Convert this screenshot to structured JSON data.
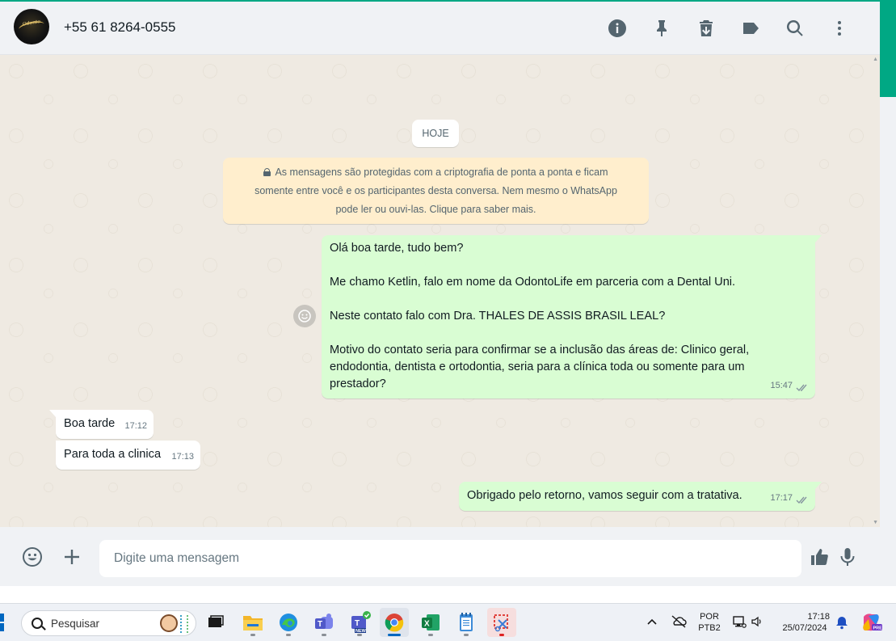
{
  "header": {
    "contact_name": "+55 61 8264-0555",
    "avatar_text": "Odonto",
    "icons": [
      "info-icon",
      "pin-icon",
      "delete-icon",
      "label-icon",
      "search-icon",
      "more-options-icon"
    ]
  },
  "chat": {
    "date_chip": "HOJE",
    "encryption_notice": "As mensagens são protegidas com a criptografia de ponta a ponta e ficam\nsomente entre você e os participantes desta conversa. Nem mesmo o WhatsApp\npode ler ou ouvi-las. Clique para saber mais.",
    "messages": [
      {
        "direction": "out",
        "text": "Olá boa tarde, tudo bem?\n\nMe chamo Ketlin, falo em nome da OdontoLife em parceria com a Dental Uni.\n\nNeste contato falo com Dra. THALES DE ASSIS BRASIL LEAL?\n\nMotivo do contato seria para confirmar se a inclusão das áreas de: Clinico geral,\nendodontia, dentista e ortodontia, seria para a clínica toda ou somente para um\nprestador?",
        "time": "15:47",
        "status": "read"
      },
      {
        "direction": "in",
        "text": "Boa tarde",
        "time": "17:12"
      },
      {
        "direction": "in",
        "text": "Para toda a clinica",
        "time": "17:13"
      },
      {
        "direction": "out",
        "text": "Obrigado pelo retorno, vamos seguir com a tratativa.",
        "time": "17:17",
        "status": "read"
      }
    ]
  },
  "composer": {
    "placeholder": "Digite uma mensagem",
    "icons": [
      "emoji-icon",
      "attach-plus-icon",
      "sticker-icon",
      "microphone-icon"
    ]
  },
  "taskbar": {
    "search_label": "Pesquisar",
    "apps": [
      "task-view-icon",
      "file-explorer-icon",
      "edge-icon",
      "teams-icon",
      "teams-new-icon",
      "chrome-icon",
      "excel-icon",
      "notepad-icon",
      "snipping-tool-icon"
    ],
    "new_badge": "NEW",
    "language_line1": "POR",
    "language_line2": "PTB2",
    "clock_time": "17:18",
    "clock_date": "25/07/2024",
    "copilot_badge": "PRE"
  },
  "colors": {
    "accent": "#00a884",
    "outgoing_bubble": "#d9fdd3",
    "incoming_bubble": "#ffffff",
    "notice_bg": "#ffeecd",
    "read_ticks": "#8696a0"
  }
}
